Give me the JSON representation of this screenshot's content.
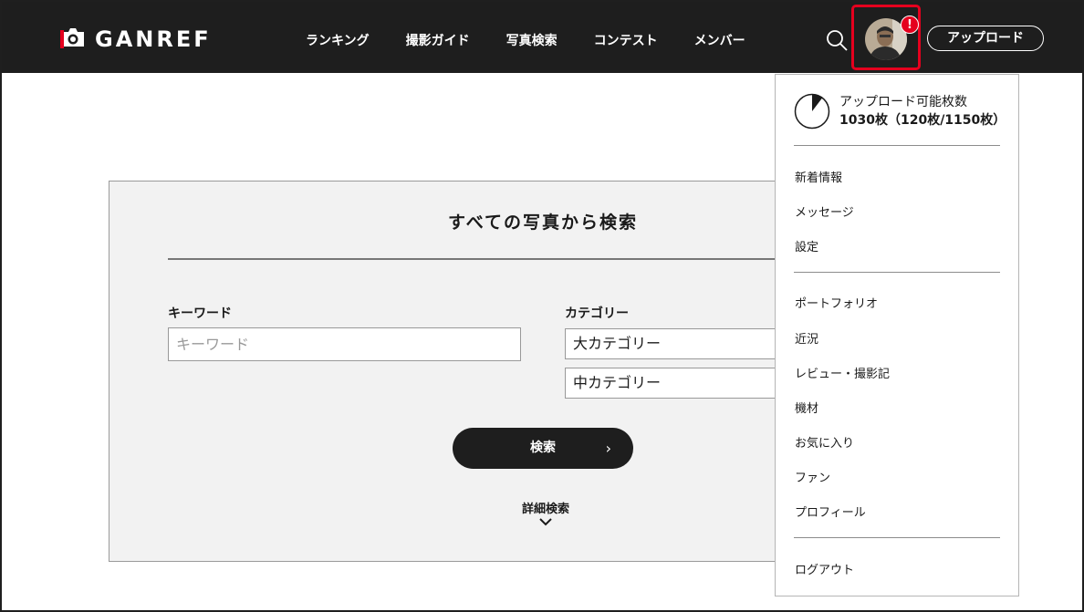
{
  "header": {
    "logo_text": "GANREF",
    "nav": [
      "ランキング",
      "撮影ガイド",
      "写真検索",
      "コンテスト",
      "メンバー"
    ],
    "notification_badge": "!",
    "upload_label": "アップロード"
  },
  "search_panel": {
    "title": "すべての写真から検索",
    "keyword_label": "キーワード",
    "keyword_placeholder": "キーワード",
    "category_label": "カテゴリー",
    "category_major": "大カテゴリー",
    "category_middle": "中カテゴリー",
    "search_button": "検索",
    "advanced_search": "詳細検索"
  },
  "user_menu": {
    "quota_label": "アップロード可能枚数",
    "quota_value": "1030枚（120枚/1150枚）",
    "quota_used_fraction": 0.104,
    "group1": [
      "新着情報",
      "メッセージ",
      "設定"
    ],
    "group2": [
      "ポートフォリオ",
      "近況",
      "レビュー・撮影記",
      "機材",
      "お気に入り",
      "ファン",
      "プロフィール"
    ],
    "logout": "ログアウト"
  }
}
